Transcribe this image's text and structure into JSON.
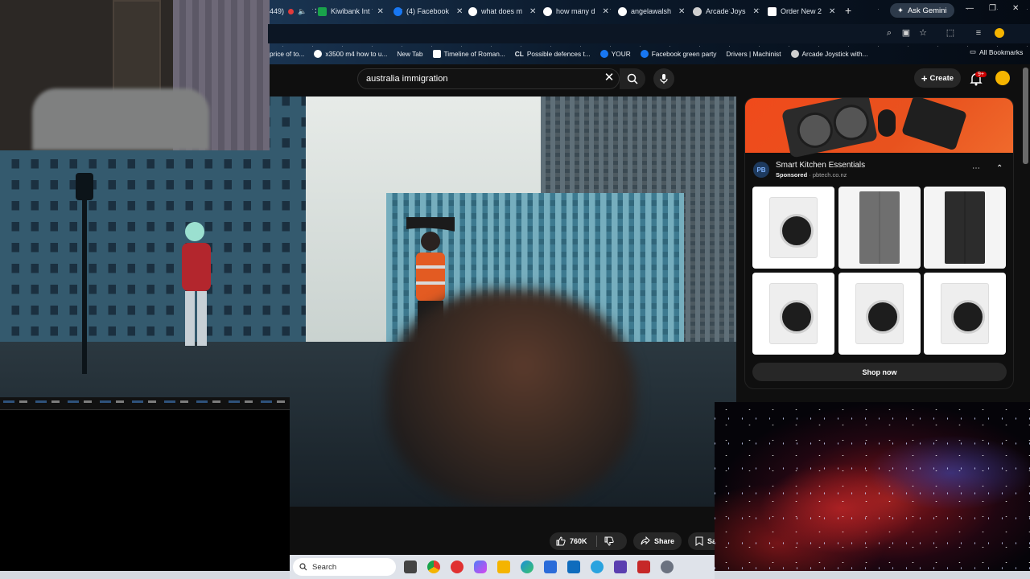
{
  "browser": {
    "tabs": [
      {
        "label": "449)",
        "color": "#e23b3b"
      },
      {
        "label": "Kiwibank Int",
        "color": "#19a34b"
      },
      {
        "label": "(4) Facebook",
        "color": "#1877f2"
      },
      {
        "label": "what does m",
        "color": "#ffffff"
      },
      {
        "label": "how many d",
        "color": "#ffffff"
      },
      {
        "label": "angelawalsh",
        "color": "#ffffff"
      },
      {
        "label": "Arcade Joys",
        "color": "#cfcfcf"
      },
      {
        "label": "Order New 2",
        "color": "#ffffff"
      }
    ],
    "ask_gemini": "Ask Gemini",
    "bookmarks": [
      {
        "label": "price of to...",
        "color": ""
      },
      {
        "label": "x3500 m4 how to u...",
        "color": "#ffffff"
      },
      {
        "label": "New Tab",
        "color": ""
      },
      {
        "label": "Timeline of Roman...",
        "color": "#ffffff"
      },
      {
        "label": "Possible defences t...",
        "color": "#ffffff"
      },
      {
        "label": "YOUR",
        "color": "#1877f2"
      },
      {
        "label": "Facebook green party",
        "color": "#1877f2"
      },
      {
        "label": "Drivers | Machinist",
        "color": ""
      },
      {
        "label": "Arcade Joystick with...",
        "color": "#cfcfcf"
      }
    ],
    "all_bookmarks": "All Bookmarks"
  },
  "youtube": {
    "search_value": "australia immigration",
    "create_label": "Create",
    "notification_badge": "9+",
    "actions": {
      "likes": "760K",
      "share": "Share",
      "save": "Save"
    }
  },
  "ad": {
    "logo_text": "PB",
    "title": "Smart Kitchen Essentials",
    "sponsored": "Sponsored",
    "domain": "pbtech.co.nz",
    "button": "Shop now",
    "products": [
      "washer",
      "fridge-silver",
      "fridge-black",
      "washer",
      "dryer",
      "washer-black-door"
    ]
  },
  "taskbar": {
    "search_placeholder": "Search",
    "apps": [
      {
        "name": "task-view",
        "color": "#444444"
      },
      {
        "name": "chrome",
        "color": "#e33b2e"
      },
      {
        "name": "app-red",
        "color": "#e03131"
      },
      {
        "name": "copilot",
        "color": "#4f7cf7"
      },
      {
        "name": "file-explorer",
        "color": "#f4b400"
      },
      {
        "name": "edge",
        "color": "#1b8fd9"
      },
      {
        "name": "store",
        "color": "#2b6cd9"
      },
      {
        "name": "outlook",
        "color": "#0f6cbd"
      },
      {
        "name": "telegram",
        "color": "#2aa3df"
      },
      {
        "name": "app-purple",
        "color": "#5b3fb0"
      },
      {
        "name": "app-flash",
        "color": "#c62828"
      },
      {
        "name": "settings",
        "color": "#6b7280"
      }
    ]
  }
}
